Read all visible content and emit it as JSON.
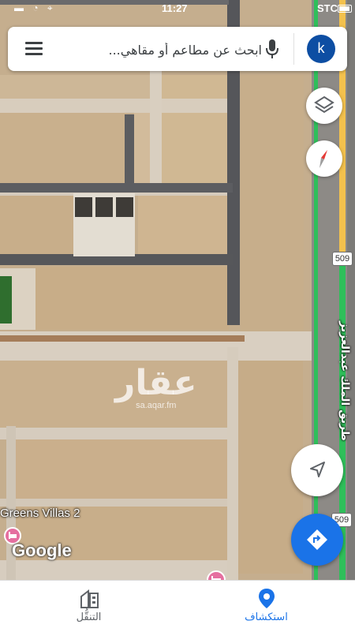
{
  "status_bar": {
    "carrier": "STC",
    "time": "11:27"
  },
  "search": {
    "placeholder": "ابحث عن مطاعم أو مقاهي...",
    "avatar_letter": "k"
  },
  "map": {
    "road_shield_number": "509",
    "road_name": "طريق الملك عبدالعزيز",
    "place_name": "Greens Villas 2",
    "attribution": "Google",
    "watermark_brand": "عقار",
    "watermark_domain": "sa.aqar.fm"
  },
  "controls": {
    "layers_icon": "layers-icon",
    "compass_icon": "compass-icon",
    "locate_icon": "my-location-icon",
    "directions_icon": "directions-icon"
  },
  "tabs": [
    {
      "label": "استكشاف",
      "icon": "place-pin-icon",
      "active": true
    },
    {
      "label": "التنقُّل",
      "icon": "commute-icon",
      "active": false
    }
  ],
  "colors": {
    "accent": "#1a73e8",
    "avatar": "#0d4ea3",
    "road_green": "#2fbf5a",
    "road_yellow": "#f3c14d"
  }
}
